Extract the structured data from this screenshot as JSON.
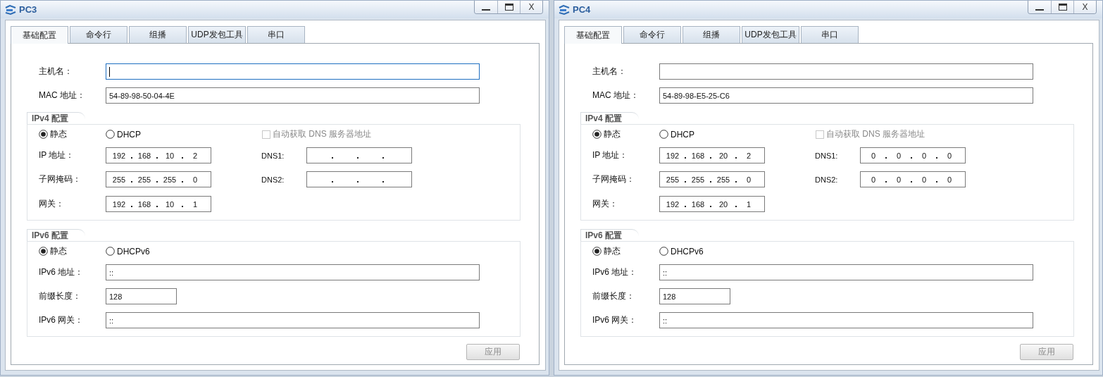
{
  "windows": [
    {
      "title": "PC3",
      "window_controls": {
        "close": "X"
      },
      "tabs": [
        {
          "label": "基础配置",
          "selected": true
        },
        {
          "label": "命令行",
          "selected": false
        },
        {
          "label": "组播",
          "selected": false
        },
        {
          "label": "UDP发包工具",
          "selected": false
        },
        {
          "label": "串口",
          "selected": false
        }
      ],
      "host_name": {
        "label": "主机名：",
        "focused": true
      },
      "mac": {
        "label": "MAC 地址：",
        "value": "54-89-98-50-04-4E"
      },
      "ipv4": {
        "title": "IPv4 配置",
        "modes": [
          {
            "label": "静态",
            "selected": true
          },
          {
            "label": "DHCP",
            "selected": false
          }
        ],
        "auto_dns": {
          "label": "自动获取 DNS 服务器地址",
          "checked": false,
          "disabled": true
        },
        "ip": {
          "label": "IP 地址：",
          "octets": [
            "192",
            "168",
            "10",
            "2"
          ]
        },
        "mask": {
          "label": "子网掩码：",
          "octets": [
            "255",
            "255",
            "255",
            "0"
          ]
        },
        "gateway": {
          "label": "网关：",
          "octets": [
            "192",
            "168",
            "10",
            "1"
          ]
        },
        "dns1": {
          "label": "DNS1:"
        },
        "dns2": {
          "label": "DNS2:"
        }
      },
      "ipv6": {
        "title": "IPv6 配置",
        "modes": [
          {
            "label": "静态",
            "selected": true
          },
          {
            "label": "DHCPv6",
            "selected": false
          }
        ],
        "address": {
          "label": "IPv6 地址：",
          "value": "::"
        },
        "prefix": {
          "label": "前缀长度：",
          "value": "128"
        },
        "gateway": {
          "label": "IPv6 网关：",
          "value": "::"
        }
      },
      "apply_button": {
        "label": "应用",
        "disabled": true
      }
    },
    {
      "title": "PC4",
      "window_controls": {
        "close": "X"
      },
      "tabs": [
        {
          "label": "基础配置",
          "selected": true
        },
        {
          "label": "命令行",
          "selected": false
        },
        {
          "label": "组播",
          "selected": false
        },
        {
          "label": "UDP发包工具",
          "selected": false
        },
        {
          "label": "串口",
          "selected": false
        }
      ],
      "host_name": {
        "label": "主机名：",
        "focused": false
      },
      "mac": {
        "label": "MAC 地址：",
        "value": "54-89-98-E5-25-C6"
      },
      "ipv4": {
        "title": "IPv4 配置",
        "modes": [
          {
            "label": "静态",
            "selected": true
          },
          {
            "label": "DHCP",
            "selected": false
          }
        ],
        "auto_dns": {
          "label": "自动获取 DNS 服务器地址",
          "checked": false,
          "disabled": true
        },
        "ip": {
          "label": "IP 地址：",
          "octets": [
            "192",
            "168",
            "20",
            "2"
          ]
        },
        "mask": {
          "label": "子网掩码：",
          "octets": [
            "255",
            "255",
            "255",
            "0"
          ]
        },
        "gateway": {
          "label": "网关：",
          "octets": [
            "192",
            "168",
            "20",
            "1"
          ]
        },
        "dns1": {
          "label": "DNS1:",
          "octets": [
            "0",
            "0",
            "0",
            "0"
          ]
        },
        "dns2": {
          "label": "DNS2:",
          "octets": [
            "0",
            "0",
            "0",
            "0"
          ]
        }
      },
      "ipv6": {
        "title": "IPv6 配置",
        "modes": [
          {
            "label": "静态",
            "selected": true
          },
          {
            "label": "DHCPv6",
            "selected": false
          }
        ],
        "address": {
          "label": "IPv6 地址：",
          "value": "::"
        },
        "prefix": {
          "label": "前缀长度：",
          "value": "128"
        },
        "gateway": {
          "label": "IPv6 网关：",
          "value": "::"
        }
      },
      "apply_button": {
        "label": "应用",
        "disabled": true
      }
    }
  ]
}
